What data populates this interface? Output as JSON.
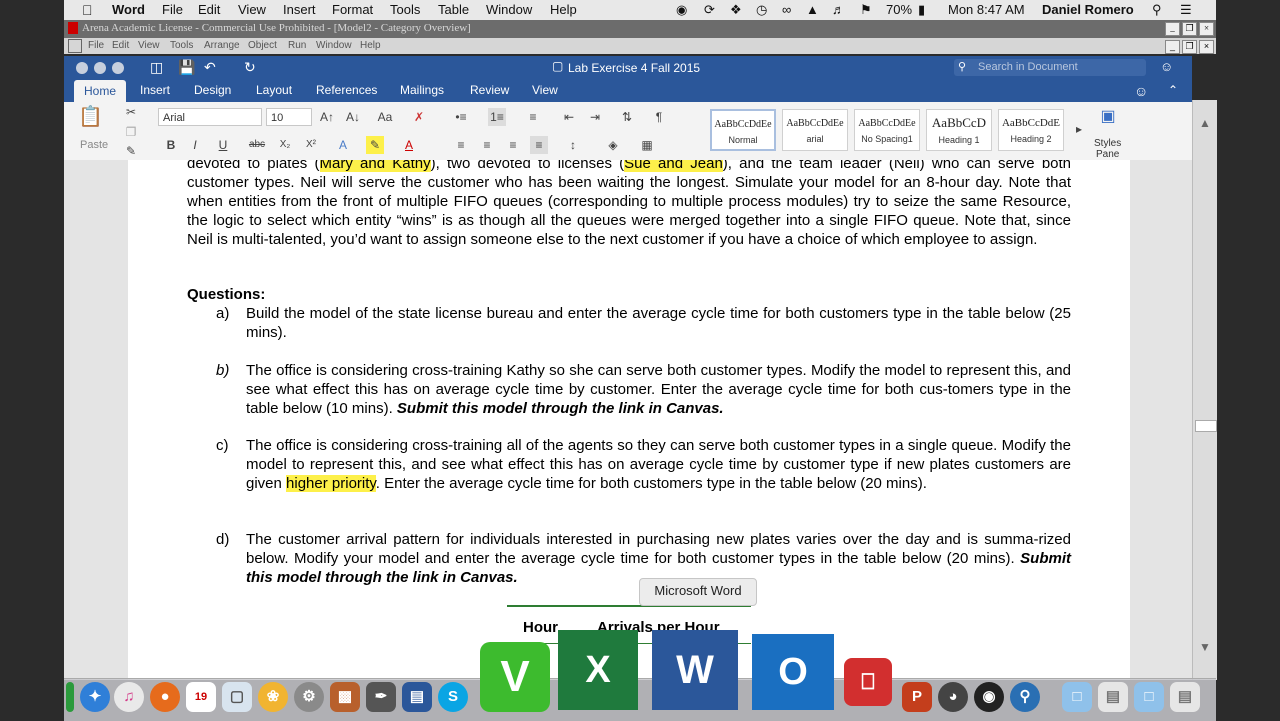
{
  "menubar": {
    "app": "Word",
    "items": [
      "File",
      "Edit",
      "View",
      "Insert",
      "Format",
      "Tools",
      "Table",
      "Window",
      "Help"
    ],
    "battery": "70%",
    "clock": "Mon 8:47 AM",
    "user": "Daniel Romero"
  },
  "arena": {
    "title": "Arena Academic License - Commercial Use Prohibited - [Model2 - Category Overview]",
    "menu": [
      "File",
      "Edit",
      "View",
      "Tools",
      "Arrange",
      "Object",
      "Run",
      "Window",
      "Help"
    ]
  },
  "word": {
    "doc_title": "Lab Exercise 4 Fall 2015",
    "search_placeholder": "Search in Document",
    "tabs": [
      "Home",
      "Insert",
      "Design",
      "Layout",
      "References",
      "Mailings",
      "Review",
      "View"
    ],
    "font_name": "Arial",
    "font_size": "10",
    "paste_label": "Paste",
    "styles": [
      {
        "sample": "AaBbCcDdEe",
        "name": "Normal"
      },
      {
        "sample": "AaBbCcDdEe",
        "name": "arial"
      },
      {
        "sample": "AaBbCcDdEe",
        "name": "No Spacing1"
      },
      {
        "sample": "AaBbCcD",
        "name": "Heading 1"
      },
      {
        "sample": "AaBbCcDdE",
        "name": "Heading 2"
      }
    ],
    "styles_pane_1": "Styles",
    "styles_pane_2": "Pane"
  },
  "document": {
    "intro_a": "devoted to plates (",
    "intro_hl1": "Mary and Kathy",
    "intro_b": "), two devoted to licenses (",
    "intro_hl2": "Sue and Jean",
    "intro_c": "), and the team leader (Neil) who can serve both customer types. Neil will serve the customer who has been waiting the longest. Simulate your model for an 8-hour day. Note that when entities from the front of multiple FIFO queues (corresponding to multiple process modules) try to seize the same Resource, the logic to select which entity “wins”  is as though all the queues were merged together into a single FIFO queue. Note that, since Neil is multi-talented, you’d want to assign someone else to the next customer if you have a choice of which employee to assign.",
    "questions_heading": "Questions:",
    "q": [
      {
        "label": "a)",
        "text": "Build the model of the state license bureau and enter the average cycle time for both customers type in the table below (25 mins).",
        "bold": ""
      },
      {
        "label": "b)",
        "text": "The office is considering cross-training Kathy so she can serve both customer types. Modify the model to represent this, and see what effect this has on average cycle time by customer. Enter the average cycle time for both cus-tomers type in the table below (10 mins). ",
        "bold": "Submit this model through the link in Canvas."
      },
      {
        "label": "c)",
        "text": "",
        "bold": ""
      },
      {
        "label": "d)",
        "text": "The customer arrival pattern for individuals interested in purchasing new plates varies over the day and is summa-rized below. Modify your model and enter the average cycle time for both customer types in the table below (20 mins). ",
        "bold": "Submit this model through the link in Canvas."
      }
    ],
    "qc_a": " The office is considering cross-training all of the agents so they can serve both customer types in a single queue. Modify the model to represent this, and see what effect this has on average cycle time by customer type if new plates customers are given ",
    "qc_hl": "higher priority",
    "qc_b": ". Enter the average cycle time for both customers type in the table below (20 mins).",
    "table_h1": "Hour",
    "table_h2": "Arrivals per Hour"
  },
  "tooltip": "Microsoft Word",
  "dock_icons": [
    "finder-icon",
    "safari-icon",
    "itunes-icon",
    "firefox-icon",
    "calendar-icon",
    "preview-icon",
    "photos-icon",
    "system-preferences-icon",
    "keynote-icon",
    "pixelmator-icon",
    "word-icon",
    "skype-icon",
    "vensim-icon",
    "excel-icon",
    "word-icon",
    "outlook-icon",
    "remote-desktop-icon",
    "powerpoint-icon",
    "other-icon"
  ],
  "colors": {
    "word_blue": "#2b579a",
    "highlight": "#fdf04a"
  }
}
